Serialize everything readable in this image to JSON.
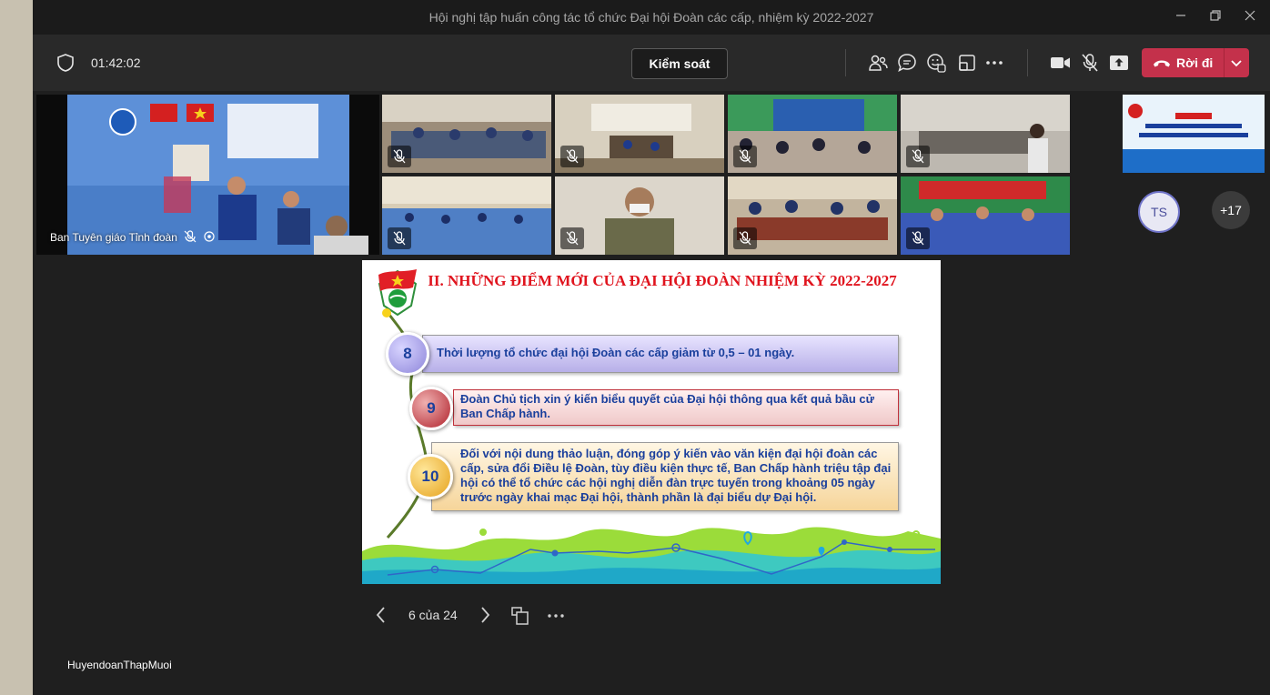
{
  "window": {
    "title": "Hội nghị tập huấn công tác tổ chức Đại hội Đoàn các cấp, nhiệm kỳ 2022-2027"
  },
  "toolbar": {
    "timer": "01:42:02",
    "control_label": "Kiểm soát",
    "leave_label": "Rời đi",
    "icons": [
      "shield-icon",
      "people-icon",
      "chat-icon",
      "reactions-icon",
      "rooms-icon",
      "more-icon",
      "camera-icon",
      "mic-muted-icon",
      "share-icon",
      "phone-icon",
      "chevron-down-icon"
    ]
  },
  "participants": {
    "main_speaker_label": "Ban Tuyên giáo Tỉnh đoàn",
    "avatar_initials": "TS",
    "overflow_count": "+17"
  },
  "slide": {
    "title": "II. NHỮNG ĐIỂM MỚI CỦA ĐẠI HỘI ĐOÀN NHIỆM KỲ 2022-2027",
    "items": [
      {
        "number": "8",
        "text": "Thời lượng tổ chức đại hội Đoàn các cấp giảm từ 0,5 – 01 ngày."
      },
      {
        "number": "9",
        "text": "Đoàn Chủ tịch xin ý kiến biểu quyết của Đại hội thông qua kết quả bầu cử Ban Chấp hành."
      },
      {
        "number": "10",
        "text": "Đối với nội dung thảo luận, đóng góp ý kiến vào văn kiện đại hội đoàn các cấp, sửa đổi Điều lệ Đoàn, tùy điều kiện thực tế, Ban Chấp hành triệu tập đại hội có thể tổ chức các hội nghị diễn đàn trực tuyến trong khoảng 05 ngày trước ngày khai mạc Đại hội, thành phần là đại biểu dự Đại hội."
      }
    ]
  },
  "pager": {
    "page_label": "6 của 24"
  },
  "presenter_name": "HuyendoanThapMuoi",
  "colors": {
    "leave_button": "#c4314b",
    "slide_title": "#e0141e",
    "slide_text": "#1a3f9c"
  }
}
